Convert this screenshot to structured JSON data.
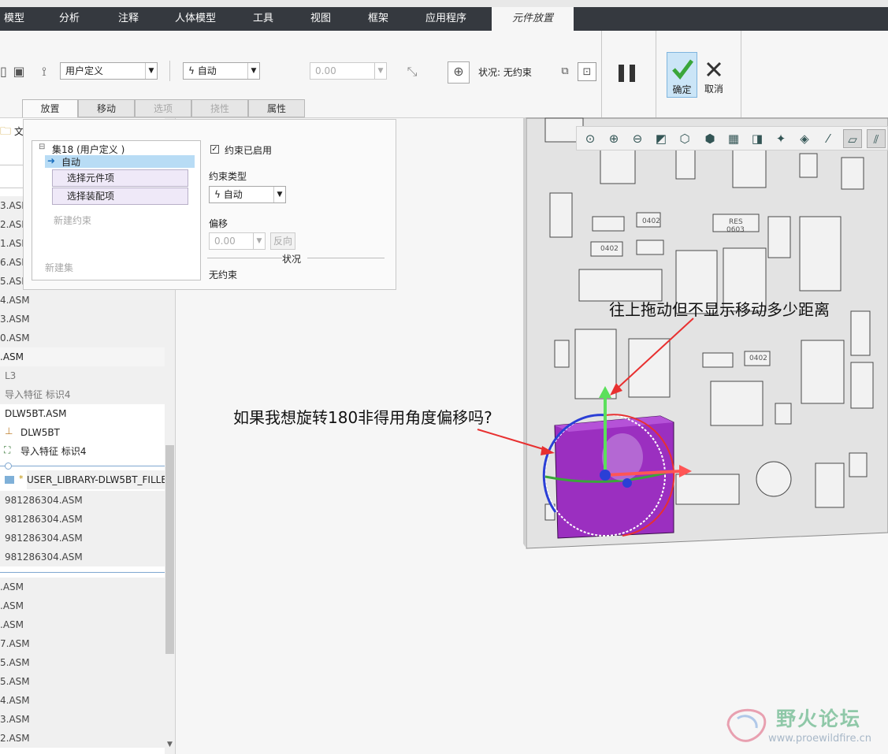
{
  "ribbon": {
    "tabs": [
      "模型",
      "分析",
      "注释",
      "人体模型",
      "工具",
      "视图",
      "框架",
      "应用程序",
      "元件放置"
    ],
    "active_tab": "元件放置"
  },
  "toolbar": {
    "constraint_set_type": "用户定义",
    "constraint_type": "自动",
    "offset_value": "0.00",
    "status_label": "状况: 无约束",
    "confirm_label": "确定",
    "cancel_label": "取消"
  },
  "subtabs": {
    "placement": "放置",
    "move": "移动",
    "options": "选项",
    "flexibility": "挠性",
    "properties": "属性"
  },
  "placement_panel": {
    "set_name": "集18 (用户定义 )",
    "constraint_item": "自动",
    "select_component": "选择元件项",
    "select_assembly": "选择装配项",
    "new_constraint": "新建约束",
    "new_set": "新建集",
    "constraint_enabled_label": "约束已启用",
    "constraint_enabled": true,
    "constraint_type_label": "约束类型",
    "constraint_type_value": "自动",
    "offset_label": "偏移",
    "offset_value": "0.00",
    "flip_label": "反向",
    "status_heading": "状况",
    "status_value": "无约束"
  },
  "tree": {
    "top_label": "文",
    "rows": [
      "3.ASM",
      "2.ASM",
      "1.ASM",
      "6.ASM",
      "5.ASM",
      "4.ASM",
      "3.ASM",
      "0.ASM",
      ".ASM",
      "L3",
      "导入特征 标识4",
      "DLW5BT.ASM",
      "DLW5BT",
      "导入特征 标识4",
      "USER_LIBRARY-DLW5BT_FILLE",
      "981286304.ASM",
      "981286304.ASM",
      "981286304.ASM",
      "981286304.ASM",
      ".ASM",
      ".ASM",
      ".ASM",
      "7.ASM",
      "5.ASM",
      "5.ASM",
      "4.ASM",
      "3.ASM",
      "2.ASM"
    ]
  },
  "annotations": {
    "drag_note": "往上拖动但不显示移动多少距离",
    "rotate_note": "如果我想旋转180非得用角度偏移吗?"
  },
  "board_labels": {
    "res": "RES",
    "size_0603": "0603",
    "size_0402": "0402"
  },
  "watermark": {
    "name": "野火论坛",
    "url": "www.proewildfire.cn"
  },
  "colors": {
    "ribbon_bg": "#35393f",
    "accent_green": "#3aa63a",
    "component_purple": "#9b2fc0",
    "arrow_red": "#e83030",
    "axis_blue": "#2b3fd6"
  }
}
